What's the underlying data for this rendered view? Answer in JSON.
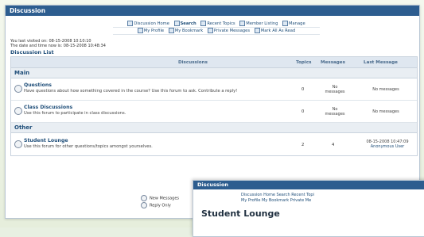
{
  "app": {
    "title": "Discussion"
  },
  "nav": {
    "row1": [
      "Discussion Home",
      "Search",
      "Recent Topics",
      "Member Listing",
      "Manage"
    ],
    "row2": [
      "My Profile",
      "My Bookmark",
      "Private Messages",
      "Mark All As Read"
    ]
  },
  "visit": {
    "last": "You last visited on: 08-15-2008 10:10:10",
    "now": "The date and time now is: 08-15-2008 10:48:34"
  },
  "list_title": "Discussion List",
  "table": {
    "headers": {
      "discussions": "Discussions",
      "topics": "Topics",
      "messages": "Messages",
      "last": "Last Message"
    },
    "sections": [
      {
        "name": "Main",
        "forums": [
          {
            "title": "Questions",
            "desc": "Have questions about how something covered in the course? Use this forum to ask. Contribute a reply!",
            "topics": "0",
            "messages": "No messages",
            "last": "No messages",
            "last_user": ""
          },
          {
            "title": "Class Discussions",
            "desc": "Use this forum to participate in class discussions.",
            "topics": "0",
            "messages": "No messages",
            "last": "No messages",
            "last_user": ""
          }
        ]
      },
      {
        "name": "Other",
        "forums": [
          {
            "title": "Student Lounge",
            "desc": "Use this forum for other questions/topics amongst yourselves.",
            "topics": "2",
            "messages": "4",
            "last": "08-15-2008 10:47:09",
            "last_user": "Anonymous User"
          }
        ]
      }
    ]
  },
  "legend": {
    "new": "New Messages",
    "reply": "Reply Only"
  },
  "panel2": {
    "title": "Discussion",
    "nav_row1": "Discussion Home  Search  Recent Topi",
    "nav_row2": "My Profile  My Bookmark  Private Me",
    "heading": "Student Lounge"
  },
  "colors": {
    "titlebar": "#2d5d8f",
    "link": "#1f4e79"
  }
}
